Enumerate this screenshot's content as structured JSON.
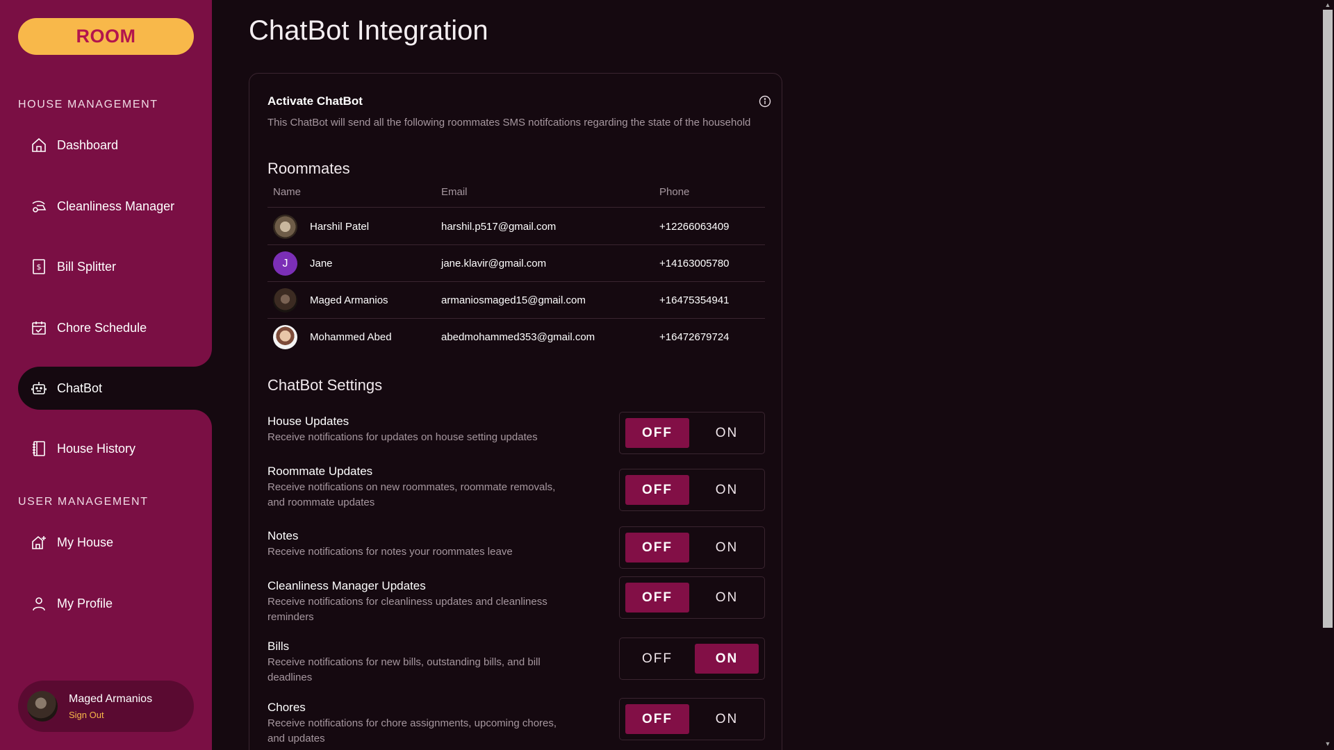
{
  "sidebar": {
    "logo": "ROOM",
    "section_house": "HOUSE MANAGEMENT",
    "section_user": "USER MANAGEMENT",
    "items": [
      {
        "label": "Dashboard",
        "icon": "home-icon"
      },
      {
        "label": "Cleanliness Manager",
        "icon": "vacuum-icon"
      },
      {
        "label": "Bill Splitter",
        "icon": "bill-icon"
      },
      {
        "label": "Chore Schedule",
        "icon": "calendar-icon"
      },
      {
        "label": "ChatBot",
        "icon": "robot-icon",
        "active": true
      },
      {
        "label": "House History",
        "icon": "book-icon"
      },
      {
        "label": "My House",
        "icon": "house-plus-icon"
      },
      {
        "label": "My Profile",
        "icon": "user-icon"
      }
    ],
    "user": {
      "name": "Maged Armanios",
      "sign_out": "Sign Out"
    }
  },
  "main": {
    "title": "ChatBot Integration",
    "activate": {
      "title": "Activate ChatBot",
      "description": "This ChatBot will send all the following roommates SMS notifcations regarding the state of the household"
    },
    "roommates": {
      "heading": "Roommates",
      "columns": [
        "Name",
        "Email",
        "Phone"
      ],
      "rows": [
        {
          "name": "Harshil Patel",
          "email": "harshil.p517@gmail.com",
          "phone": "+12266063409",
          "avatar_letter": ""
        },
        {
          "name": "Jane",
          "email": "jane.klavir@gmail.com",
          "phone": "+14163005780",
          "avatar_letter": "J"
        },
        {
          "name": "Maged Armanios",
          "email": "armaniosmaged15@gmail.com",
          "phone": "+16475354941",
          "avatar_letter": ""
        },
        {
          "name": "Mohammed Abed",
          "email": "abedmohammed353@gmail.com",
          "phone": "+16472679724",
          "avatar_letter": ""
        }
      ]
    },
    "settings": {
      "heading": "ChatBot Settings",
      "off_label": "OFF",
      "on_label": "ON",
      "items": [
        {
          "title": "House Updates",
          "desc": "Receive notifications for updates on house setting updates",
          "value": "OFF"
        },
        {
          "title": "Roommate Updates",
          "desc": "Receive notifications on new roommates, roommate removals, and roommate updates",
          "value": "OFF"
        },
        {
          "title": "Notes",
          "desc": "Receive notifications for notes your roommates leave",
          "value": "OFF"
        },
        {
          "title": "Cleanliness Manager Updates",
          "desc": "Receive notifications for cleanliness updates and cleanliness reminders",
          "value": "OFF"
        },
        {
          "title": "Bills",
          "desc": "Receive notifications for new bills, outstanding bills, and bill deadlines",
          "value": "ON"
        },
        {
          "title": "Chores",
          "desc": "Receive notifications for chore assignments, upcoming chores, and updates",
          "value": "OFF"
        }
      ]
    }
  },
  "colors": {
    "sidebar_bg": "#7a0f44",
    "page_bg": "#150910",
    "accent_yellow": "#f8b84a",
    "toggle_selected": "#820f46"
  }
}
